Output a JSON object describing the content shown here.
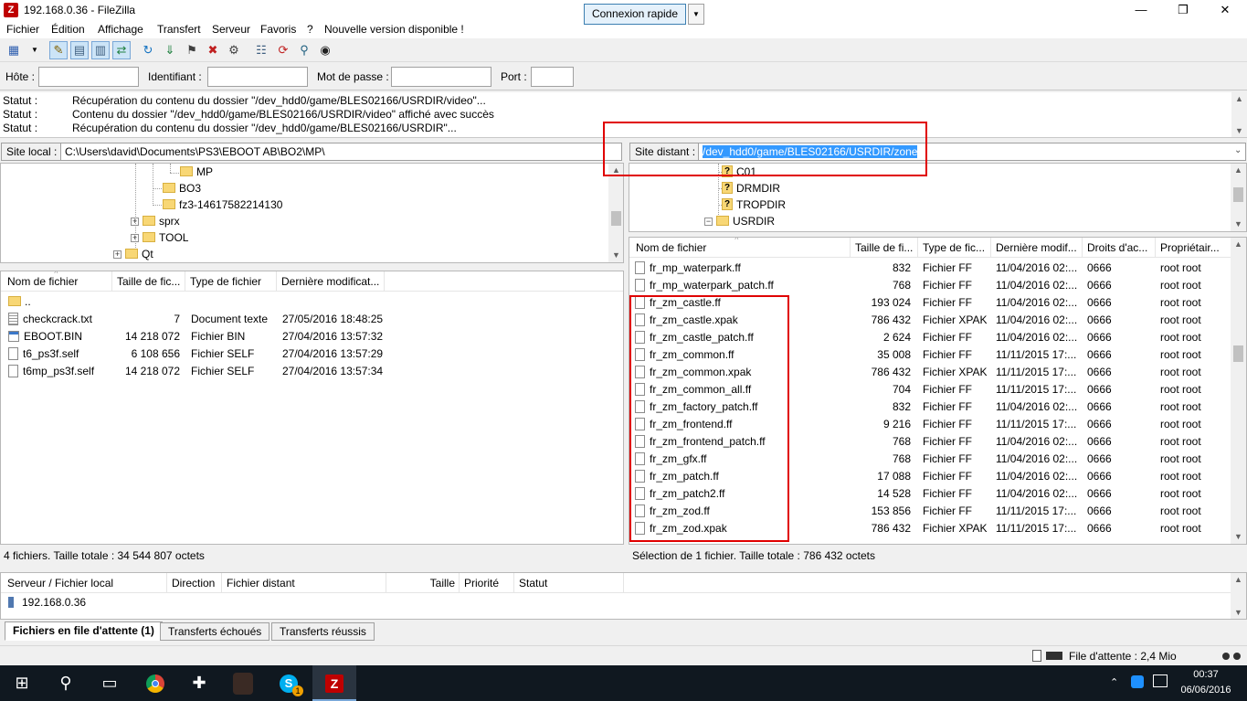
{
  "window": {
    "title": "192.168.0.36 - FileZilla",
    "app_icon_letter": "Z"
  },
  "menu": [
    "Fichier",
    "Édition",
    "Affichage",
    "Transfert",
    "Serveur",
    "Favoris",
    "?",
    "Nouvelle version disponible !"
  ],
  "quickconnect": {
    "host_label": "Hôte :",
    "host_value": "",
    "user_label": "Identifiant :",
    "user_value": "",
    "pass_label": "Mot de passe :",
    "pass_value": "",
    "port_label": "Port :",
    "port_value": "",
    "connect_label": "Connexion rapide"
  },
  "log": [
    {
      "k": "Statut :",
      "v": "Récupération du contenu du dossier \"/dev_hdd0/game/BLES02166/USRDIR/video\"..."
    },
    {
      "k": "Statut :",
      "v": "Contenu du dossier \"/dev_hdd0/game/BLES02166/USRDIR/video\" affiché avec succès"
    },
    {
      "k": "Statut :",
      "v": "Récupération du contenu du dossier \"/dev_hdd0/game/BLES02166/USRDIR\"..."
    }
  ],
  "local": {
    "site_label": "Site local :",
    "path": "C:\\Users\\david\\Documents\\PS3\\EBOOT AB\\BO2\\MP\\",
    "tree": [
      "MP",
      "BO3",
      "fz3-14617582214130",
      "sprx",
      "TOOL",
      "Qt"
    ],
    "columns": [
      "Nom de fichier",
      "Taille de fic...",
      "Type de fichier",
      "Dernière modificat..."
    ],
    "files": [
      {
        "name": "..",
        "size": "",
        "type": "",
        "date": ""
      },
      {
        "name": "checkcrack.txt",
        "size": "7",
        "type": "Document texte",
        "date": "27/05/2016 18:48:25"
      },
      {
        "name": "EBOOT.BIN",
        "size": "14 218 072",
        "type": "Fichier BIN",
        "date": "27/04/2016 13:57:32"
      },
      {
        "name": "t6_ps3f.self",
        "size": "6 108 656",
        "type": "Fichier SELF",
        "date": "27/04/2016 13:57:29"
      },
      {
        "name": "t6mp_ps3f.self",
        "size": "14 218 072",
        "type": "Fichier SELF",
        "date": "27/04/2016 13:57:34"
      }
    ],
    "status": "4 fichiers. Taille totale : 34 544 807 octets"
  },
  "remote": {
    "site_label": "Site distant :",
    "path": "/dev_hdd0/game/BLES02166/USRDIR/zone",
    "tree": [
      "C01",
      "DRMDIR",
      "TROPDIR",
      "USRDIR"
    ],
    "tree_q_mark": "?",
    "columns": [
      "Nom de fichier",
      "Taille de fi...",
      "Type de fic...",
      "Dernière modif...",
      "Droits d'ac...",
      "Propriétair..."
    ],
    "files": [
      {
        "name": "fr_mp_waterpark.ff",
        "size": "832",
        "type": "Fichier FF",
        "date": "11/04/2016 02:...",
        "perm": "0666",
        "owner": "root root"
      },
      {
        "name": "fr_mp_waterpark_patch.ff",
        "size": "768",
        "type": "Fichier FF",
        "date": "11/04/2016 02:...",
        "perm": "0666",
        "owner": "root root"
      },
      {
        "name": "fr_zm_castle.ff",
        "size": "193 024",
        "type": "Fichier FF",
        "date": "11/04/2016 02:...",
        "perm": "0666",
        "owner": "root root"
      },
      {
        "name": "fr_zm_castle.xpak",
        "size": "786 432",
        "type": "Fichier XPAK",
        "date": "11/04/2016 02:...",
        "perm": "0666",
        "owner": "root root"
      },
      {
        "name": "fr_zm_castle_patch.ff",
        "size": "2 624",
        "type": "Fichier FF",
        "date": "11/04/2016 02:...",
        "perm": "0666",
        "owner": "root root"
      },
      {
        "name": "fr_zm_common.ff",
        "size": "35 008",
        "type": "Fichier FF",
        "date": "11/11/2015 17:...",
        "perm": "0666",
        "owner": "root root"
      },
      {
        "name": "fr_zm_common.xpak",
        "size": "786 432",
        "type": "Fichier XPAK",
        "date": "11/11/2015 17:...",
        "perm": "0666",
        "owner": "root root"
      },
      {
        "name": "fr_zm_common_all.ff",
        "size": "704",
        "type": "Fichier FF",
        "date": "11/11/2015 17:...",
        "perm": "0666",
        "owner": "root root"
      },
      {
        "name": "fr_zm_factory_patch.ff",
        "size": "832",
        "type": "Fichier FF",
        "date": "11/04/2016 02:...",
        "perm": "0666",
        "owner": "root root"
      },
      {
        "name": "fr_zm_frontend.ff",
        "size": "9 216",
        "type": "Fichier FF",
        "date": "11/11/2015 17:...",
        "perm": "0666",
        "owner": "root root"
      },
      {
        "name": "fr_zm_frontend_patch.ff",
        "size": "768",
        "type": "Fichier FF",
        "date": "11/04/2016 02:...",
        "perm": "0666",
        "owner": "root root"
      },
      {
        "name": "fr_zm_gfx.ff",
        "size": "768",
        "type": "Fichier FF",
        "date": "11/04/2016 02:...",
        "perm": "0666",
        "owner": "root root"
      },
      {
        "name": "fr_zm_patch.ff",
        "size": "17 088",
        "type": "Fichier FF",
        "date": "11/04/2016 02:...",
        "perm": "0666",
        "owner": "root root"
      },
      {
        "name": "fr_zm_patch2.ff",
        "size": "14 528",
        "type": "Fichier FF",
        "date": "11/04/2016 02:...",
        "perm": "0666",
        "owner": "root root"
      },
      {
        "name": "fr_zm_zod.ff",
        "size": "153 856",
        "type": "Fichier FF",
        "date": "11/11/2015 17:...",
        "perm": "0666",
        "owner": "root root"
      },
      {
        "name": "fr_zm_zod.xpak",
        "size": "786 432",
        "type": "Fichier XPAK",
        "date": "11/11/2015 17:...",
        "perm": "0666",
        "owner": "root root"
      }
    ],
    "status": "Sélection de 1 fichier. Taille totale : 786 432 octets"
  },
  "queue": {
    "columns": [
      "Serveur / Fichier local",
      "Direction",
      "Fichier distant",
      "Taille",
      "Priorité",
      "Statut"
    ],
    "server": "192.168.0.36"
  },
  "tabs": [
    "Fichiers en file d'attente (1)",
    "Transferts échoués",
    "Transferts réussis"
  ],
  "bottom": {
    "queue_status": "File d'attente : 2,4 Mio"
  },
  "taskbar": {
    "time": "00:37",
    "date": "06/06/2016",
    "skype_badge": "1"
  },
  "colors": {
    "highlight_box": "#e00000",
    "selection": "#3399ff",
    "filezilla_red": "#bf0000"
  }
}
